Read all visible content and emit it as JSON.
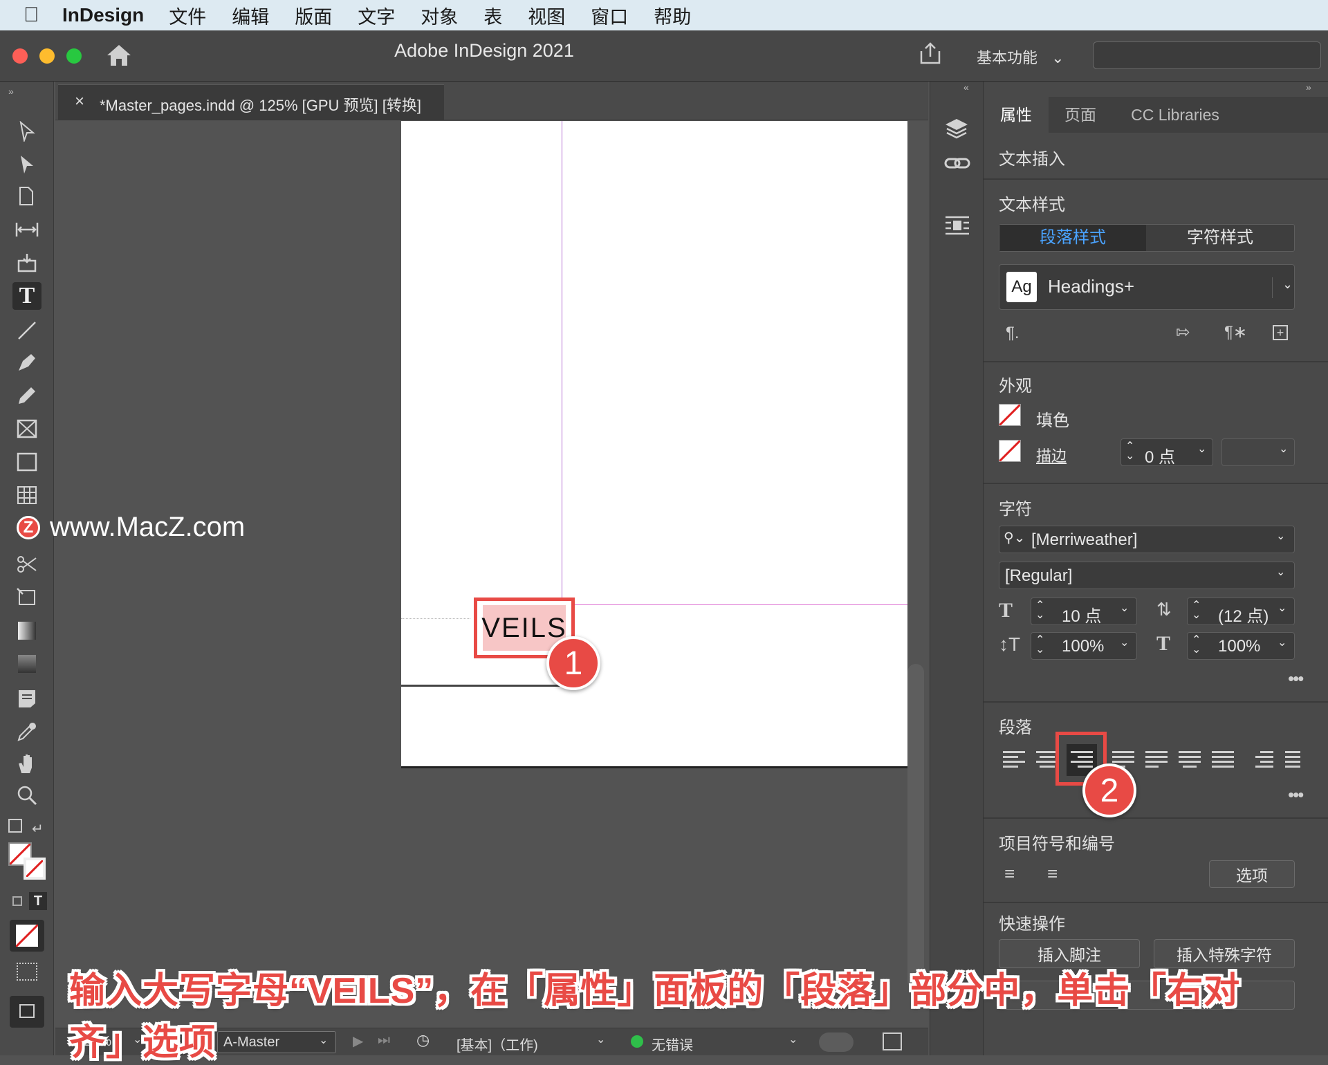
{
  "menubar": {
    "app": "InDesign",
    "items": [
      "文件",
      "编辑",
      "版面",
      "文字",
      "对象",
      "表",
      "视图",
      "窗口",
      "帮助"
    ]
  },
  "titlebar": {
    "title": "Adobe InDesign 2021",
    "workspace": "基本功能"
  },
  "document_tab": {
    "close": "×",
    "label": "*Master_pages.indd @ 125% [GPU 预览] [转换]"
  },
  "canvas": {
    "frame_text": "VEILS",
    "step1": "1",
    "step2": "2"
  },
  "watermark": {
    "logo": "Z",
    "text": "www.MacZ.com"
  },
  "properties": {
    "tabs": [
      "属性",
      "页面",
      "CC Libraries"
    ],
    "active_tab": "属性",
    "text_insert": "文本插入",
    "text_style": {
      "title": "文本样式",
      "para_style_tab": "段落样式",
      "char_style_tab": "字符样式",
      "style_icon": "Ag",
      "style_value": "Headings+"
    },
    "appearance": {
      "title": "外观",
      "fill": "填色",
      "stroke": "描边",
      "stroke_value": "0 点"
    },
    "character": {
      "title": "字符",
      "font": "[Merriweather]",
      "style": "[Regular]",
      "size": "10 点",
      "leading": "(12 点)",
      "vscale": "100%",
      "hscale": "100%"
    },
    "paragraph": {
      "title": "段落",
      "selected_alignment": "align-right"
    },
    "bullets": {
      "title": "项目符号和编号",
      "options_button": "选项"
    },
    "quick_actions": {
      "title": "快速操作",
      "insert_footnote": "插入脚注",
      "insert_special": "插入特殊字符"
    }
  },
  "statusbar": {
    "zoom": "125%",
    "page": "A-Master",
    "profile": "[基本]（工作)",
    "errors": "无错误"
  },
  "caption": "输入大写字母“VEILS”，在「属性」面板的「段落」部分中，单击「右对齐」选项",
  "colors": {
    "accent_red": "#e84a45",
    "selected_tab_blue": "#4aa3ff",
    "guide_purple": "#b36bd0"
  }
}
